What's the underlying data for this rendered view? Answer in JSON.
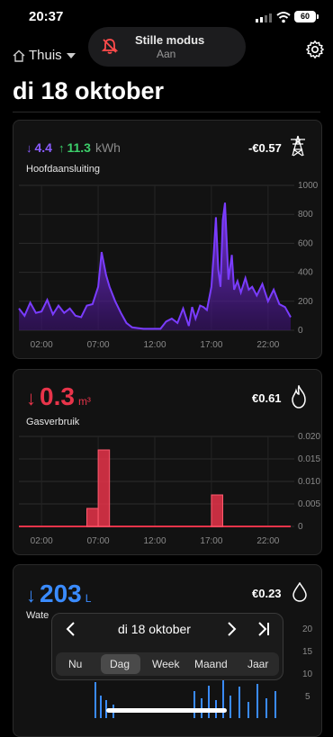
{
  "status": {
    "time": "20:37",
    "battery": "60"
  },
  "focus": {
    "title": "Stille modus",
    "subtitle": "Aan"
  },
  "header": {
    "location": "Thuis",
    "date_title": "di 18 oktober"
  },
  "electricity": {
    "import_value": "4.4",
    "export_value": "11.3",
    "unit": "kWh",
    "price": "-€0.57",
    "label": "Hoofdaansluiting",
    "icon": "power-pylon-icon",
    "color": "#7a3cff",
    "export_color": "#3ccf6a",
    "chart_data": {
      "type": "area",
      "x_ticks": [
        "02:00",
        "07:00",
        "12:00",
        "17:00",
        "22:00"
      ],
      "y_ticks": [
        "1000",
        "800",
        "600",
        "400",
        "200",
        "0"
      ],
      "ylim": [
        0,
        1000
      ],
      "x_range_hours": [
        0,
        24
      ],
      "grid": true,
      "series": [
        {
          "x": [
            0,
            0.5,
            1,
            1.5,
            2,
            2.5,
            3,
            3.5,
            4,
            4.5,
            5,
            5.5,
            6,
            6.5,
            7,
            7.3,
            7.7,
            8,
            8.5,
            9,
            9.5,
            10,
            10.5,
            11,
            11.5,
            12,
            12.5,
            13,
            13.5,
            14,
            14.5,
            15,
            15.3,
            15.6,
            16,
            16.3,
            16.6,
            17,
            17.2,
            17.4,
            17.6,
            17.8,
            18,
            18.2,
            18.5,
            18.8,
            19,
            19.3,
            19.6,
            20,
            20.3,
            20.6,
            21,
            21.5,
            22,
            22.5,
            23,
            23.5,
            24
          ],
          "values": [
            150,
            100,
            190,
            120,
            130,
            210,
            110,
            170,
            120,
            150,
            100,
            90,
            170,
            180,
            300,
            540,
            380,
            300,
            200,
            120,
            50,
            20,
            15,
            10,
            10,
            10,
            10,
            60,
            80,
            50,
            150,
            30,
            160,
            80,
            170,
            160,
            140,
            300,
            520,
            780,
            420,
            300,
            760,
            880,
            350,
            520,
            280,
            340,
            260,
            360,
            280,
            300,
            240,
            320,
            200,
            280,
            180,
            160,
            90
          ]
        }
      ]
    }
  },
  "gas": {
    "value": "0.3",
    "unit": "m³",
    "price": "€0.61",
    "label": "Gasverbruik",
    "icon": "flame-icon",
    "color": "#e8344a",
    "chart_data": {
      "type": "bar",
      "x_ticks": [
        "02:00",
        "07:00",
        "12:00",
        "17:00",
        "22:00"
      ],
      "y_ticks": [
        "0.020",
        "0.015",
        "0.010",
        "0.005",
        "0"
      ],
      "ylim": [
        0,
        0.02
      ],
      "grid": true,
      "bars": [
        {
          "start": 6,
          "end": 7,
          "value": 0.004
        },
        {
          "start": 7,
          "end": 8,
          "value": 0.017
        },
        {
          "start": 17,
          "end": 18,
          "value": 0.007
        }
      ]
    }
  },
  "water": {
    "value": "203",
    "unit": "L",
    "price": "€0.23",
    "label": "Wate",
    "icon": "water-drop-icon",
    "color": "#3a8bff",
    "y_ticks": [
      "20",
      "15",
      "10",
      "5"
    ]
  },
  "nav": {
    "date": "di 18 oktober",
    "periods": [
      "Nu",
      "Dag",
      "Week",
      "Maand",
      "Jaar"
    ],
    "selected": "Dag"
  }
}
